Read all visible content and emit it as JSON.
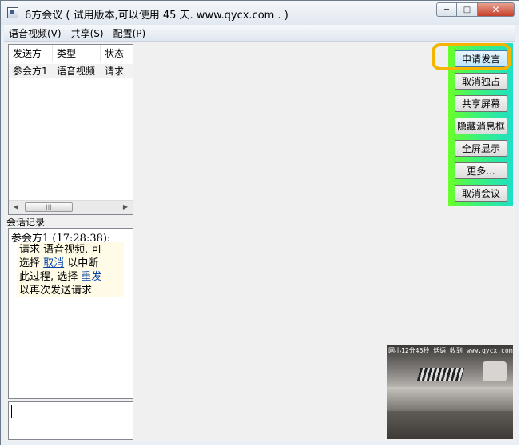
{
  "window": {
    "title": "6方会议 ( 试用版本,可以使用 45 天. www.qycx.com . )"
  },
  "menu": [
    "语音视频(V)",
    "共享(S)",
    "配置(P)"
  ],
  "participants": {
    "columns": [
      "发送方",
      "类型",
      "状态"
    ],
    "rows": [
      {
        "sender": "参会方1",
        "type": "语音视频",
        "status": "请求"
      }
    ]
  },
  "chat": {
    "section_label": "会话记录",
    "header": "参会方1 (17:28:38):",
    "line1": "请求  语音视频. 可",
    "line2_prefix": "选择 ",
    "cancel_link": "取消",
    "line2_suffix": " 以中断",
    "line3_prefix": "此过程, 选择 ",
    "resend_link": "重发",
    "line4": "以再次发送请求"
  },
  "buttons": [
    "申请发言",
    "取消独占",
    "共享屏幕",
    "隐藏消息框",
    "全屏显示",
    "更多...",
    "取消会议"
  ],
  "video": {
    "overlay_text": "网小12分46秒 话语 收到  www.qycx.com"
  },
  "colors": {
    "panel_gradient_start": "#6aff2a",
    "panel_gradient_end": "#1de0c8",
    "highlight_ring": "#f5b400",
    "link": "#0645ad"
  }
}
